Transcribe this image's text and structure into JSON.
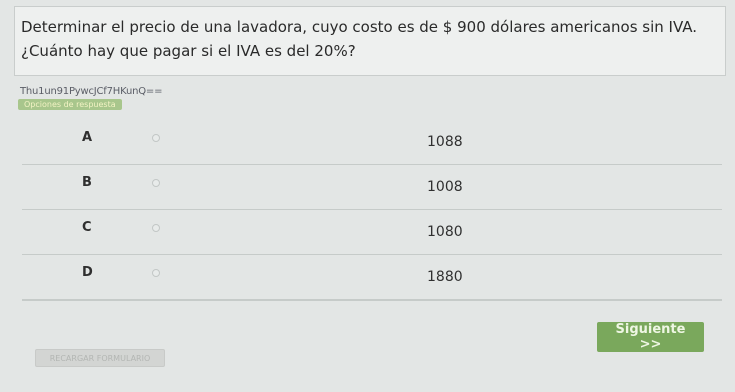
{
  "question": {
    "text": "Determinar el precio de una lavadora, cuyo costo es de $ 900 dólares americanos sin IVA. ¿Cuánto hay que pagar si el IVA es del 20%?"
  },
  "token": "Thu1un91PywcJCf7HKunQ==",
  "options_label": "Opciones de respuesta",
  "options": [
    {
      "letter": "A",
      "value": "1088"
    },
    {
      "letter": "B",
      "value": "1008"
    },
    {
      "letter": "C",
      "value": "1080"
    },
    {
      "letter": "D",
      "value": "1880"
    }
  ],
  "buttons": {
    "next": "Siguiente >>",
    "reload": "RECARGAR FORMULARIO"
  }
}
